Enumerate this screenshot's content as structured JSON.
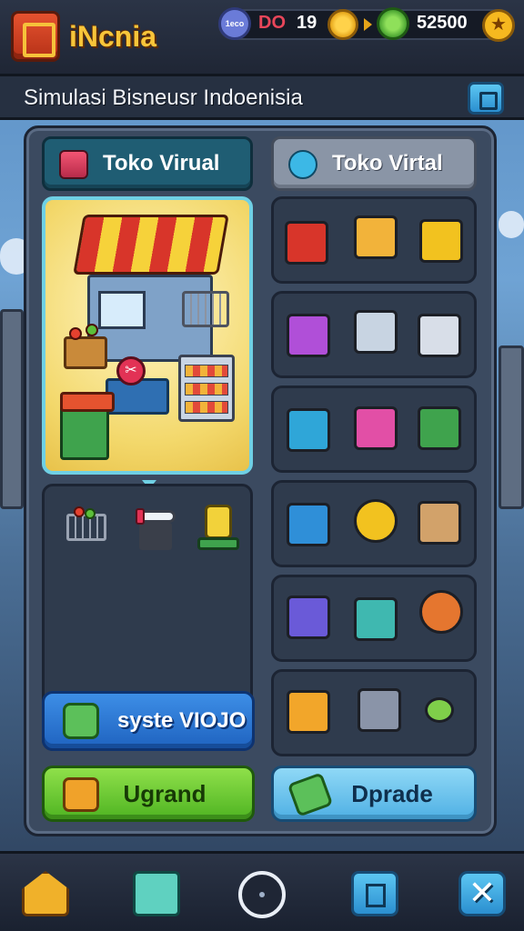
{
  "app": {
    "name": "iNcnia"
  },
  "stats": {
    "badge_text": "1eco",
    "red_value": "DO",
    "white_value": "19",
    "money": "52500"
  },
  "subtitle": "Simulasi Bisneusr Indoenisia",
  "tabs": [
    {
      "label": "Toko Virual"
    },
    {
      "label": "Toko Virtal"
    }
  ],
  "store_badge": "✂",
  "buttons": {
    "system_label": "syste VIOJO",
    "upgrade_label": "Ugrand",
    "dprade_label": "Dprade"
  },
  "colors": {
    "accent_gold": "#f7c53a",
    "tab_active": "#1f5d73",
    "upgrade_green": "#4fb422",
    "system_blue": "#1f63c0",
    "dprade_blue": "#4fb0e4"
  },
  "icons": {
    "logo": "store-logo-icon",
    "star": "star-coin-icon",
    "gear_coin": "gear-coin-icon",
    "green_coin": "green-coin-icon",
    "nav": [
      "home-icon",
      "edit-icon",
      "circle-icon",
      "document-icon",
      "close-icon"
    ]
  },
  "nav": {
    "close_glyph": "✕"
  }
}
